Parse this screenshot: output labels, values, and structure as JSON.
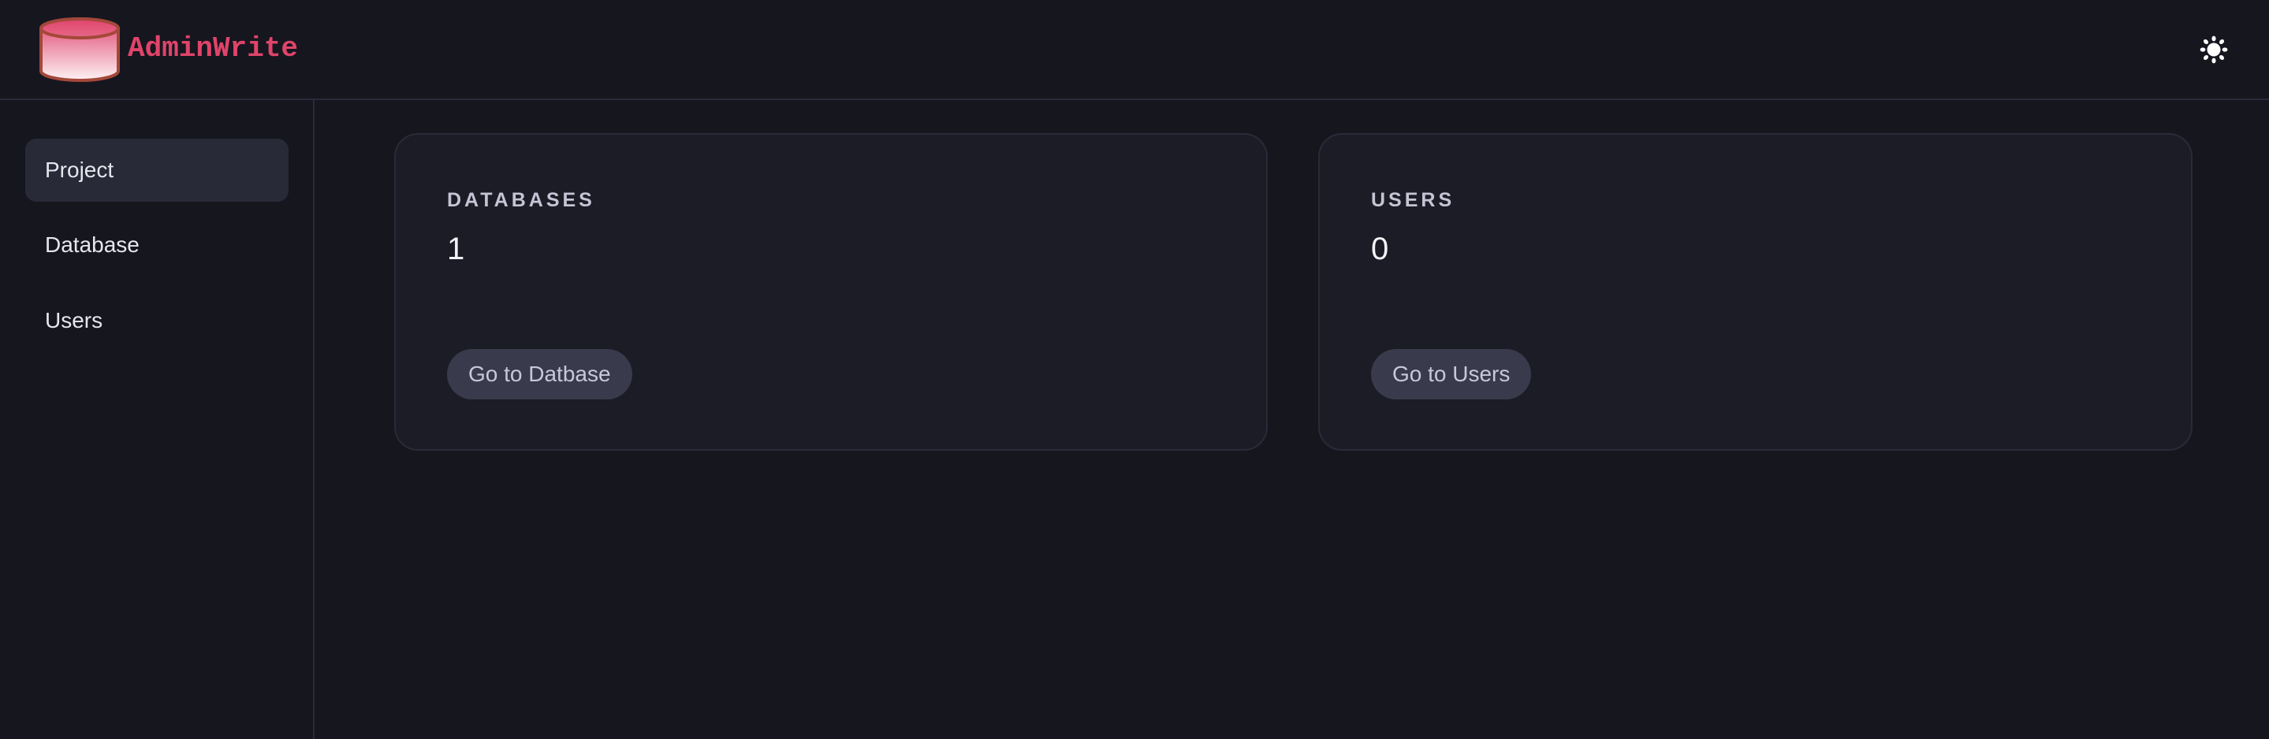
{
  "header": {
    "brand": "AdminWrite",
    "logo_icon": "database-cylinder-icon",
    "theme_toggle_icon": "sun-icon",
    "colors": {
      "brand": "#e0446a",
      "logo_stroke": "#a4483a",
      "logo_gradient_top": "#e0466e",
      "logo_gradient_bottom": "#fdf2f5"
    }
  },
  "sidebar": {
    "items": [
      {
        "label": "Project",
        "active": true
      },
      {
        "label": "Database",
        "active": false
      },
      {
        "label": "Users",
        "active": false
      }
    ]
  },
  "main": {
    "cards": [
      {
        "label": "DATABASES",
        "value": "1",
        "button": "Go to Datbase"
      },
      {
        "label": "USERS",
        "value": "0",
        "button": "Go to Users"
      }
    ]
  }
}
